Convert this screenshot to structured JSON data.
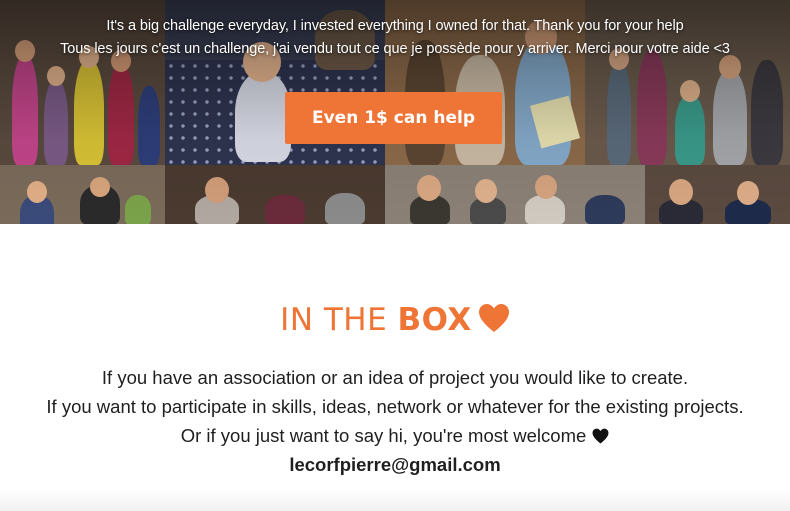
{
  "hero": {
    "line1": "It's a big challenge everyday, I invested everything I owned for that. Thank you for your help",
    "line2": "Tous les jours c'est un challenge, j'ai vendu tout ce que je possède pour y arriver. Merci pour votre aide <3",
    "button_label": "Even 1$ can help"
  },
  "in_the_box": {
    "title_light": "IN THE ",
    "title_bold": "BOX",
    "paragraph_line1": "If you have an association or an idea of project you would like to create.",
    "paragraph_line2": "If you want to participate in skills, ideas, network or whatever for the existing projects.",
    "paragraph_line3": "Or if you just want to say hi, you're most welcome",
    "email": "lecorfpierre@gmail.com"
  },
  "icons": {
    "title_heart": "heart-icon",
    "inline_heart": "black-heart-icon"
  },
  "colors": {
    "accent": "#ee7536",
    "body_text": "#1f1f1f",
    "hero_text": "#ffffff"
  }
}
